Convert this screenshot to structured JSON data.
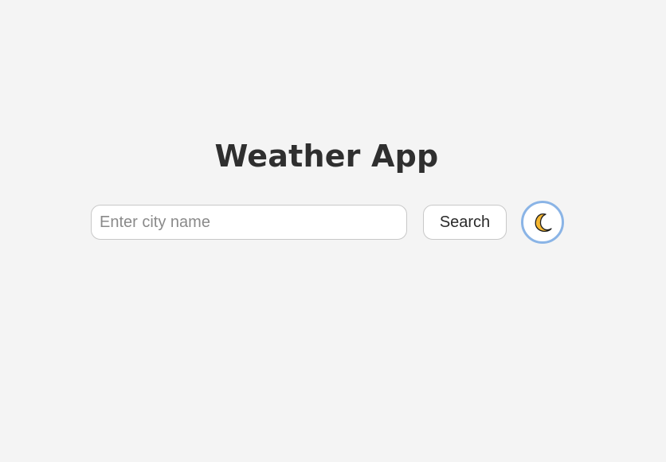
{
  "app": {
    "title": "Weather App"
  },
  "search": {
    "placeholder": "Enter city name",
    "value": "",
    "button_label": "Search"
  },
  "theme_toggle": {
    "icon": "moon-icon",
    "icon_color": "#f5b731",
    "ring_color": "#8ab4e6"
  },
  "colors": {
    "background": "#f4f4f4",
    "title": "#2f2f2f"
  }
}
